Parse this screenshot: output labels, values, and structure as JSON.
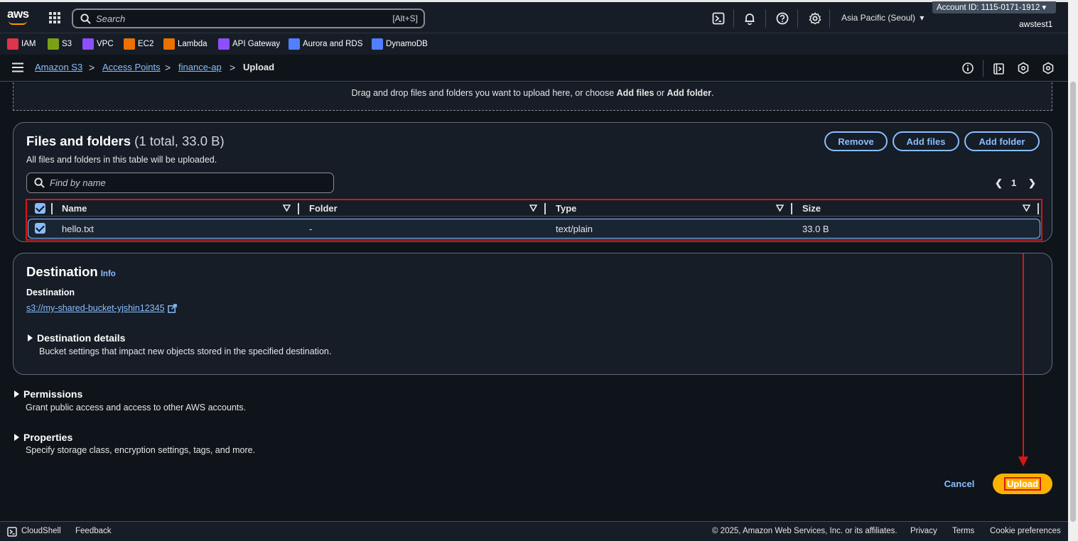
{
  "topnav": {
    "logo_text": "aws",
    "search_placeholder": "Search",
    "search_shortcut": "[Alt+S]",
    "region": "Asia Pacific (Seoul)",
    "account_id": "Account ID: 1115-0171-1912",
    "username": "awstest1",
    "icons": [
      "cloudshell-icon",
      "bell-icon",
      "help-icon",
      "gear-icon"
    ]
  },
  "favorites": [
    {
      "label": "IAM",
      "color": "#dd344c"
    },
    {
      "label": "S3",
      "color": "#7aa116"
    },
    {
      "label": "VPC",
      "color": "#8c4fff"
    },
    {
      "label": "EC2",
      "color": "#ed7100"
    },
    {
      "label": "Lambda",
      "color": "#ed7100"
    },
    {
      "label": "API Gateway",
      "color": "#8c4fff"
    },
    {
      "label": "Aurora and RDS",
      "color": "#527fff"
    },
    {
      "label": "DynamoDB",
      "color": "#527fff"
    }
  ],
  "breadcrumb": {
    "items": [
      "Amazon S3",
      "Access Points",
      "finance-ap"
    ],
    "current": "Upload"
  },
  "dropzone": {
    "text_before": "Drag and drop files and folders you want to upload here, or choose ",
    "add_files": "Add files",
    "or": " or ",
    "add_folder": "Add folder",
    "end": "."
  },
  "files": {
    "title": "Files and folders",
    "count": "(1 total, 33.0 B)",
    "description": "All files and folders in this table will be uploaded.",
    "remove_label": "Remove",
    "add_files_label": "Add files",
    "add_folder_label": "Add folder",
    "find_placeholder": "Find by name",
    "page": "1",
    "columns": [
      "Name",
      "Folder",
      "Type",
      "Size"
    ],
    "rows": [
      {
        "name": "hello.txt",
        "folder": "-",
        "type": "text/plain",
        "size": "33.0 B"
      }
    ]
  },
  "destination": {
    "title": "Destination",
    "info": "Info",
    "label": "Destination",
    "link": "s3://my-shared-bucket-yjshin12345",
    "details_title": "Destination details",
    "details_desc": "Bucket settings that impact new objects stored in the specified destination."
  },
  "permissions": {
    "title": "Permissions",
    "desc": "Grant public access and access to other AWS accounts."
  },
  "properties": {
    "title": "Properties",
    "desc": "Specify storage class, encryption settings, tags, and more."
  },
  "actions": {
    "cancel": "Cancel",
    "upload": "Upload"
  },
  "footer": {
    "cloudshell": "CloudShell",
    "feedback": "Feedback",
    "copyright": "© 2025, Amazon Web Services, Inc. or its affiliates.",
    "privacy": "Privacy",
    "terms": "Terms",
    "cookies": "Cookie preferences"
  },
  "colors": {
    "accent": "#89bdff",
    "primary_button": "#ffb100",
    "annotation": "#d91515",
    "background": "#0f141a"
  }
}
